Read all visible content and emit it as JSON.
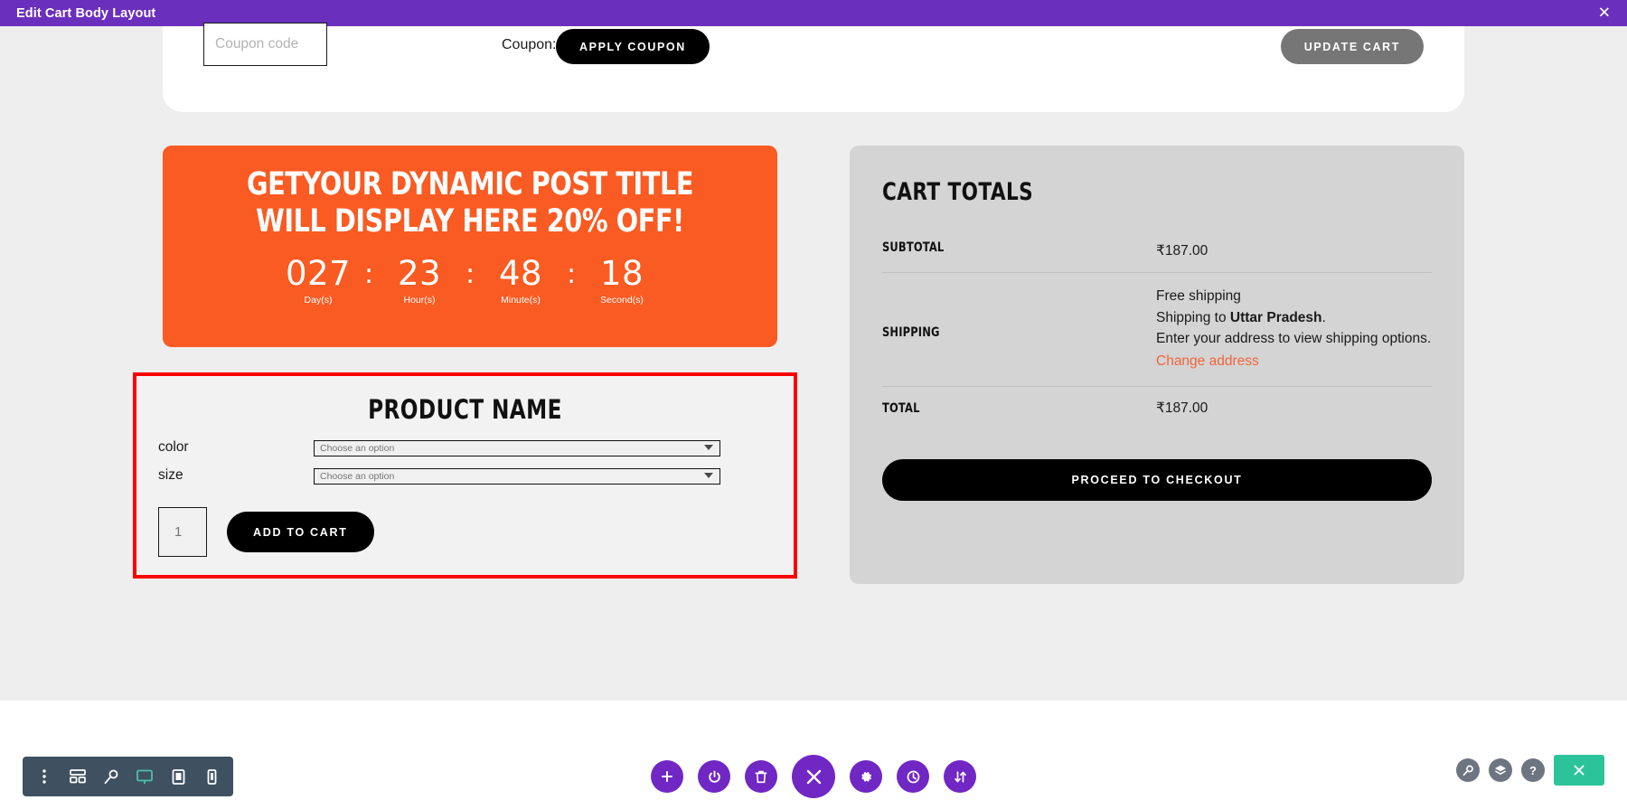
{
  "window": {
    "title": "Edit Cart Body Layout",
    "close_label": "✕",
    "accent_purple": "#6b2fbd",
    "selection_red": "#fb0000",
    "promo_orange": "#f95b22"
  },
  "coupon": {
    "input_placeholder": "Coupon code",
    "input_value": "",
    "label": "Coupon:",
    "apply_label": "APPLY COUPON",
    "update_cart_label": "UPDATE CART"
  },
  "promo": {
    "title": "GETYOUR DYNAMIC POST TITLE WILL DISPLAY HERE 20% OFF!",
    "countdown": [
      {
        "value": "027",
        "label": "Day(s)"
      },
      {
        "value": "23",
        "label": "Hour(s)"
      },
      {
        "value": "48",
        "label": "Minute(s)"
      },
      {
        "value": "18",
        "label": "Second(s)"
      }
    ],
    "separator": ":"
  },
  "product": {
    "title": "PRODUCT NAME",
    "attributes": [
      {
        "label": "color",
        "value": "Choose an option"
      },
      {
        "label": "size",
        "value": "Choose an option"
      }
    ],
    "quantity_placeholder": "1",
    "quantity_value": "",
    "add_to_cart_label": "ADD TO CART"
  },
  "cart_totals": {
    "title": "CART TOTALS",
    "subtotal_label": "SUBTOTAL",
    "subtotal_value": "₹187.00",
    "shipping_label": "SHIPPING",
    "shipping_free": "Free shipping",
    "shipping_to_prefix": "Shipping to ",
    "shipping_to_region": "Uttar Pradesh",
    "shipping_to_suffix": ".",
    "shipping_note": "Enter your address to view shipping options.",
    "change_address_label": "Change address",
    "total_label": "TOTAL",
    "total_value": "₹187.00",
    "checkout_label": "PROCEED TO CHECKOUT"
  },
  "device_toolbar": {
    "items": [
      {
        "icon": "more-vertical-icon",
        "active": false
      },
      {
        "icon": "layout-icon",
        "active": false
      },
      {
        "icon": "magnifier-icon",
        "active": false
      },
      {
        "icon": "desktop-icon",
        "active": true
      },
      {
        "icon": "tablet-icon",
        "active": false
      },
      {
        "icon": "mobile-icon",
        "active": false
      }
    ],
    "active_color": "#4fc0a8"
  },
  "center_toolbar": {
    "items": [
      {
        "icon": "plus-icon"
      },
      {
        "icon": "power-icon"
      },
      {
        "icon": "trash-icon"
      },
      {
        "icon": "close-icon"
      },
      {
        "icon": "gear-icon"
      },
      {
        "icon": "history-icon"
      },
      {
        "icon": "sort-arrows-icon"
      }
    ]
  },
  "right_toolbar": {
    "items": [
      {
        "icon": "zoom-icon"
      },
      {
        "icon": "layers-icon"
      },
      {
        "icon": "help-icon",
        "label": "?"
      }
    ],
    "exit_icon": "close-icon",
    "exit_color": "#2cc39b"
  }
}
